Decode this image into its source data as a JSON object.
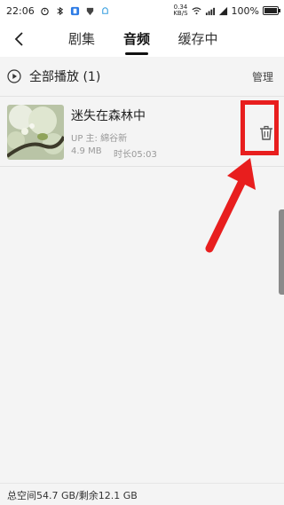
{
  "status_bar": {
    "time": "22:06",
    "net_speed_value": "0.34",
    "net_speed_unit": "KB/S",
    "battery": "100%"
  },
  "nav": {
    "tabs": [
      {
        "label": "剧集",
        "active": false
      },
      {
        "label": "音频",
        "active": true
      },
      {
        "label": "缓存中",
        "active": false
      }
    ]
  },
  "play_all": {
    "label": "全部播放 (1)",
    "manage_label": "管理"
  },
  "items": [
    {
      "title": "迷失在森林中",
      "uploader": "UP 主: 綿谷新",
      "size": "4.9 MB",
      "duration": "时长05:03"
    }
  ],
  "footer": {
    "storage": "总空间54.7 GB/剩余12.1 GB"
  },
  "colors": {
    "accent_red": "#e81e1e",
    "background": "#f4f4f4",
    "active_tab_underline": "#111111"
  },
  "icons": {
    "back": "chevron-left-icon",
    "play": "play-circle-icon",
    "delete": "trash-icon"
  }
}
